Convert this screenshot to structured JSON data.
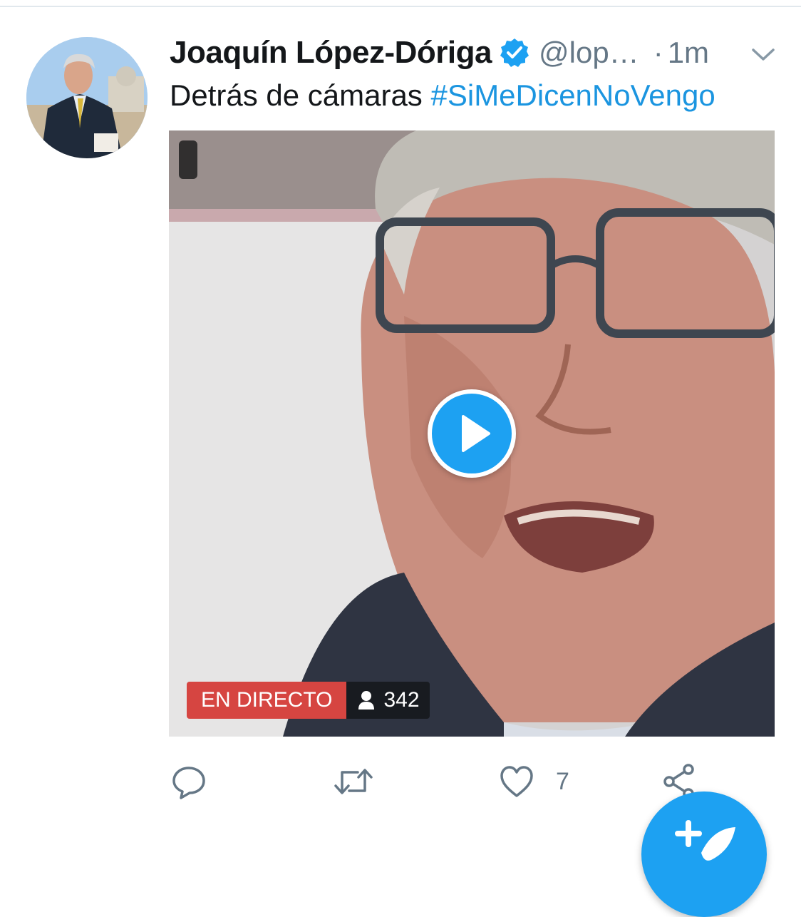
{
  "tweet": {
    "display_name": "Joaquín López-Dóriga",
    "verified": true,
    "handle": "@lop…",
    "separator": "·",
    "time": "1m",
    "text_plain": "Detrás de cámaras ",
    "hashtag": "#SiMeDicenNoVengo"
  },
  "media": {
    "live_label": "EN DIRECTO",
    "viewer_count": "342"
  },
  "actions": {
    "reply_icon": "reply-icon",
    "retweet_icon": "retweet-icon",
    "like_icon": "heart-icon",
    "like_count": "7",
    "share_icon": "share-icon"
  },
  "compose": {
    "icon": "compose-tweet-icon"
  },
  "colors": {
    "accent": "#1da1f2",
    "live": "#d64541",
    "secondary_text": "#657786"
  }
}
